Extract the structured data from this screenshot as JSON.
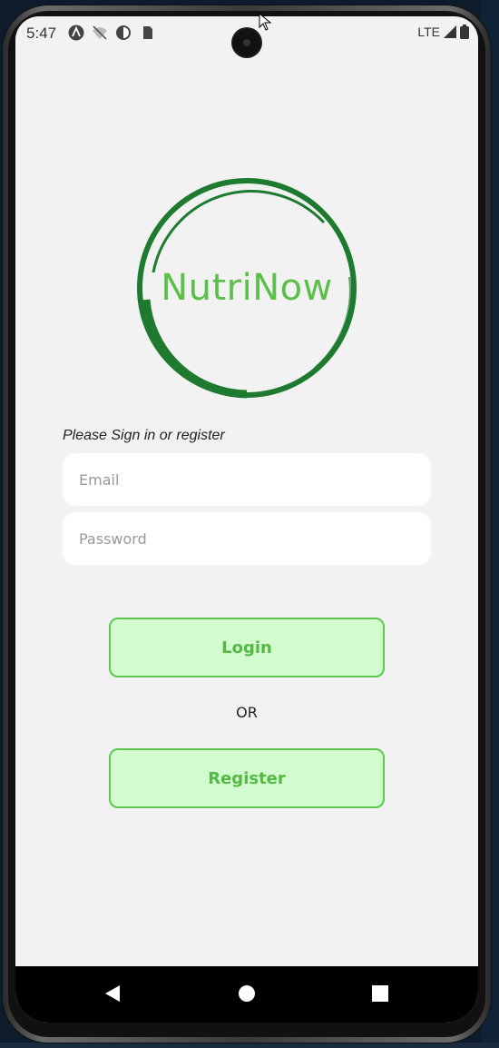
{
  "status_bar": {
    "time": "5:47",
    "network": "LTE",
    "left_icons": [
      "android-studio-icon",
      "wifi-off-icon",
      "vpn-icon",
      "sim-icon"
    ],
    "right_icons": [
      "signal-icon",
      "battery-icon"
    ]
  },
  "logo": {
    "text": "NutriNow",
    "ring_color": "#1d7a2e",
    "text_color": "#5bbf4a"
  },
  "login_form": {
    "prompt": "Please Sign in or register",
    "email_placeholder": "Email",
    "password_placeholder": "Password",
    "login_label": "Login",
    "or_label": "OR",
    "register_label": "Register"
  },
  "nav_bar": {
    "icons": [
      "back-icon",
      "home-icon",
      "recents-icon"
    ]
  },
  "colors": {
    "button_bg": "#d3fbd0",
    "button_border": "#5cc74c",
    "button_text": "#55b944",
    "screen_bg": "#f2f2f2"
  }
}
